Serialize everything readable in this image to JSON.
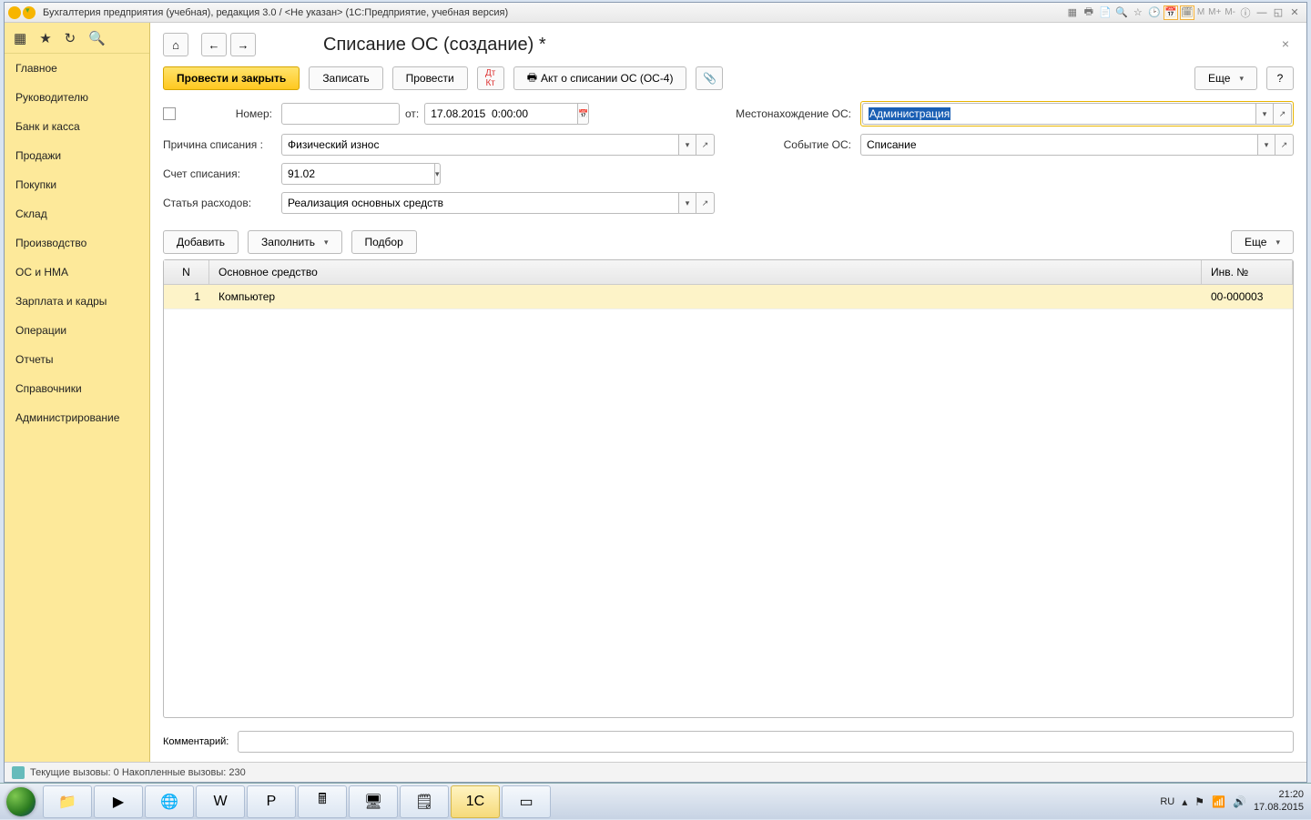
{
  "titlebar": {
    "text": "Бухгалтерия предприятия (учебная), редакция 3.0 / <Не указан>   (1С:Предприятие, учебная версия)",
    "m1": "M",
    "m2": "M+",
    "m3": "M-"
  },
  "sidebar": {
    "items": [
      "Главное",
      "Руководителю",
      "Банк и касса",
      "Продажи",
      "Покупки",
      "Склад",
      "Производство",
      "ОС и НМА",
      "Зарплата и кадры",
      "Операции",
      "Отчеты",
      "Справочники",
      "Администрирование"
    ]
  },
  "page": {
    "title": "Списание ОС (создание) *"
  },
  "toolbar": {
    "post_close": "Провести и закрыть",
    "save": "Записать",
    "post": "Провести",
    "print_act": "Акт о списании ОС (ОС-4)",
    "more": "Еще",
    "help": "?"
  },
  "form": {
    "number_label": "Номер:",
    "number": "",
    "from_label": "от:",
    "date": "17.08.2015  0:00:00",
    "location_label": "Местонахождение ОС:",
    "location": "Администрация",
    "reason_label": "Причина списания :",
    "reason": "Физический износ",
    "event_label": "Событие ОС:",
    "event": "Списание",
    "account_label": "Счет списания:",
    "account": "91.02",
    "expense_label": "Статья расходов:",
    "expense": "Реализация основных средств"
  },
  "table_toolbar": {
    "add": "Добавить",
    "fill": "Заполнить",
    "select": "Подбор",
    "more": "Еще"
  },
  "grid": {
    "col_n": "N",
    "col_name": "Основное средство",
    "col_inv": "Инв. №",
    "rows": [
      {
        "n": "1",
        "name": "Компьютер",
        "inv": "00-000003"
      }
    ]
  },
  "comment": {
    "label": "Комментарий:",
    "value": ""
  },
  "statusbar": {
    "text": "Текущие вызовы: 0   Накопленные вызовы: 230"
  },
  "tray": {
    "lang": "RU",
    "time": "21:20",
    "date": "17.08.2015"
  }
}
